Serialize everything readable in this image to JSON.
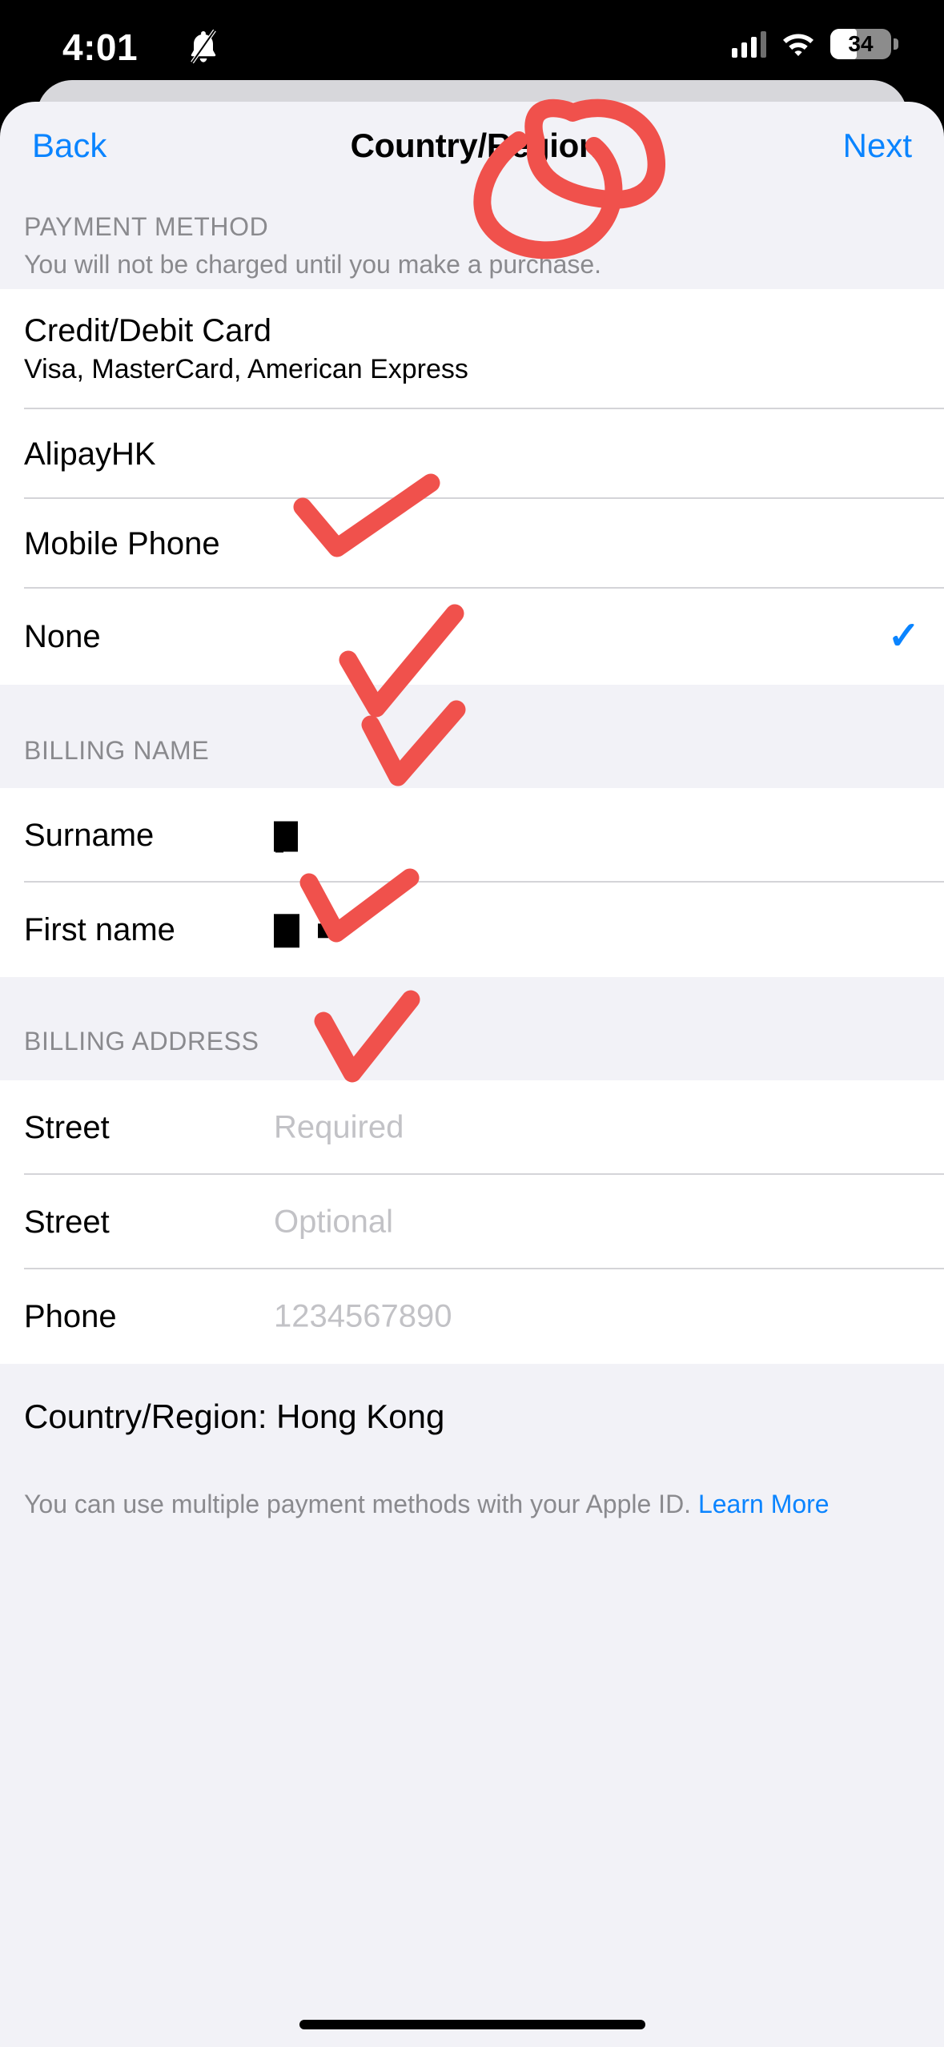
{
  "status_bar": {
    "time": "4:01",
    "bell_icon": "bell-slash-icon",
    "signal_icon": "cellular-signal-icon",
    "wifi_icon": "wifi-icon",
    "battery_level": "34"
  },
  "nav": {
    "back_label": "Back",
    "title": "Country/Region",
    "next_label": "Next"
  },
  "payment_method": {
    "header": "PAYMENT METHOD",
    "subtitle": "You will not be charged until you make a purchase.",
    "options": [
      {
        "label": "Credit/Debit Card",
        "sub": "Visa, MasterCard, American Express",
        "selected": false
      },
      {
        "label": "AlipayHK",
        "sub": "",
        "selected": false
      },
      {
        "label": "Mobile Phone",
        "sub": "",
        "selected": false
      },
      {
        "label": "None",
        "sub": "",
        "selected": true
      }
    ],
    "check_icon": "checkmark-icon"
  },
  "billing_name": {
    "header": "BILLING NAME",
    "fields": [
      {
        "label": "Surname",
        "value": "",
        "redacted": true
      },
      {
        "label": "First name",
        "value": "",
        "redacted": true
      }
    ]
  },
  "billing_address": {
    "header": "BILLING ADDRESS",
    "fields": [
      {
        "label": "Street",
        "placeholder": "Required"
      },
      {
        "label": "Street",
        "placeholder": "Optional"
      },
      {
        "label": "Phone",
        "placeholder": "1234567890"
      }
    ]
  },
  "country_row": {
    "text": "Country/Region: Hong Kong"
  },
  "footer": {
    "text": "You can use multiple payment methods with your Apple ID. ",
    "link_label": "Learn More"
  },
  "annotations": {
    "color": "#f0514c",
    "marks": [
      {
        "type": "circle",
        "target": "next-button"
      },
      {
        "type": "check",
        "target": "none-row"
      },
      {
        "type": "check",
        "target": "surname-row"
      },
      {
        "type": "check",
        "target": "first-name-row"
      },
      {
        "type": "check",
        "target": "street-required-row"
      },
      {
        "type": "check",
        "target": "phone-row"
      }
    ]
  },
  "colors": {
    "accent_blue": "#0a84ff",
    "annotation_red": "#f0514c",
    "sheet_background": "#f2f2f7",
    "row_background": "#ffffff"
  }
}
